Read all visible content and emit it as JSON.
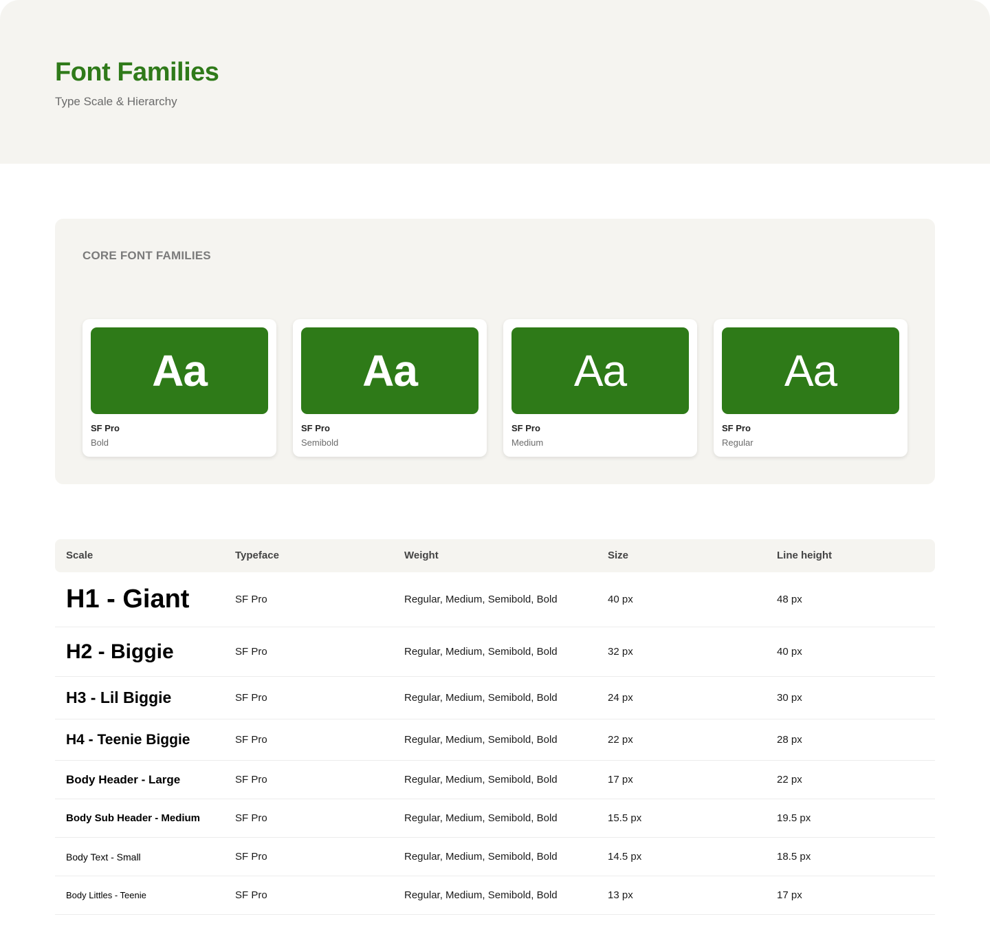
{
  "header": {
    "title": "Font Families",
    "subtitle": "Type Scale & Hierarchy"
  },
  "colors": {
    "accent": "#2e7a18",
    "panel_bg": "#f5f4f0"
  },
  "families": {
    "title": "CORE FONT FAMILIES",
    "cards": [
      {
        "glyph": "Aa",
        "name": "SF Pro",
        "weight": "Bold"
      },
      {
        "glyph": "Aa",
        "name": "SF Pro",
        "weight": "Semibold"
      },
      {
        "glyph": "Aa",
        "name": "SF Pro",
        "weight": "Medium"
      },
      {
        "glyph": "Aa",
        "name": "SF Pro",
        "weight": "Regular"
      }
    ]
  },
  "table": {
    "headers": {
      "scale": "Scale",
      "typeface": "Typeface",
      "weight": "Weight",
      "size": "Size",
      "line_height": "Line height"
    },
    "rows": [
      {
        "scale": "H1 - Giant",
        "typeface": "SF Pro",
        "weight": "Regular, Medium, Semibold, Bold",
        "size": "40 px",
        "line_height": "48 px"
      },
      {
        "scale": "H2 - Biggie",
        "typeface": "SF Pro",
        "weight": "Regular, Medium, Semibold, Bold",
        "size": "32 px",
        "line_height": "40 px"
      },
      {
        "scale": "H3 - Lil Biggie",
        "typeface": "SF Pro",
        "weight": "Regular, Medium, Semibold, Bold",
        "size": "24 px",
        "line_height": "30 px"
      },
      {
        "scale": "H4 - Teenie Biggie",
        "typeface": "SF Pro",
        "weight": "Regular, Medium, Semibold, Bold",
        "size": "22 px",
        "line_height": "28 px"
      },
      {
        "scale": "Body Header - Large",
        "typeface": "SF Pro",
        "weight": "Regular, Medium, Semibold, Bold",
        "size": "17 px",
        "line_height": "22 px"
      },
      {
        "scale": "Body Sub Header - Medium",
        "typeface": "SF Pro",
        "weight": "Regular, Medium, Semibold, Bold",
        "size": "15.5 px",
        "line_height": "19.5 px"
      },
      {
        "scale": "Body Text - Small",
        "typeface": "SF Pro",
        "weight": "Regular, Medium, Semibold, Bold",
        "size": "14.5 px",
        "line_height": "18.5 px"
      },
      {
        "scale": "Body Littles - Teenie",
        "typeface": "SF Pro",
        "weight": "Regular, Medium, Semibold, Bold",
        "size": "13 px",
        "line_height": "17 px"
      }
    ]
  }
}
